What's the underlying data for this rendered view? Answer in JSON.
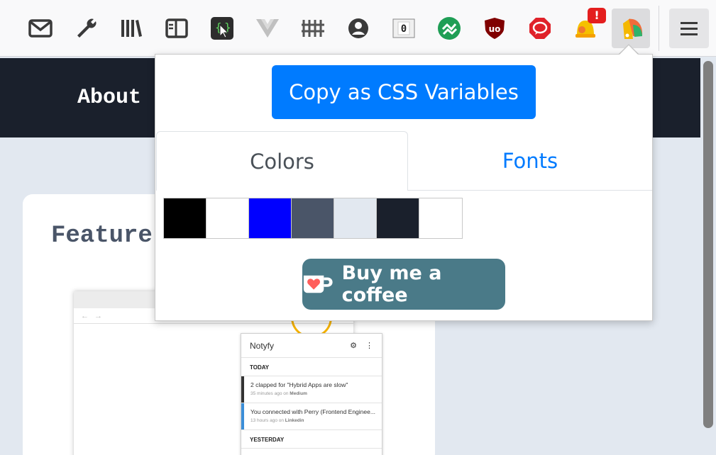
{
  "toolbar": {
    "icons": [
      {
        "name": "mail-icon"
      },
      {
        "name": "wrench-icon"
      },
      {
        "name": "library-icon"
      },
      {
        "name": "sidebar-icon"
      },
      {
        "name": "selector-icon"
      },
      {
        "name": "vue-devtools-icon"
      },
      {
        "name": "grid-icon"
      },
      {
        "name": "account-icon"
      },
      {
        "name": "counter-icon",
        "label": "0"
      },
      {
        "name": "extension-green-icon"
      },
      {
        "name": "ublock-icon",
        "label": "uo"
      },
      {
        "name": "stop-chat-icon"
      },
      {
        "name": "notification-bell-icon",
        "badge": "!"
      },
      {
        "name": "palette-extension-icon"
      }
    ]
  },
  "page": {
    "nav_about": "About",
    "card_title": "Feature",
    "mock": {
      "back": "←",
      "forward": "→",
      "app_title": "Notyfy",
      "settings_glyph": "⚙",
      "more_glyph": "⋮",
      "section_today": "TODAY",
      "items": [
        {
          "text": "2 clapped for \"Hybrid Apps are slow\"",
          "time": "35 minutes ago on",
          "source": "Medium"
        },
        {
          "text": "You connected with Perry (Frontend Enginee...",
          "time": "13 hours ago on",
          "source": "Linkedin"
        }
      ],
      "section_yesterday": "YESTERDAY"
    }
  },
  "popup": {
    "copy_button": "Copy as CSS Variables",
    "tabs": {
      "colors": "Colors",
      "fonts": "Fonts"
    },
    "active_tab": "Colors",
    "swatches": [
      "#000000",
      "#ffffff",
      "#0000ff",
      "#4a5568",
      "#e2e8f0",
      "#1a202c",
      "#ffffff"
    ],
    "coffee_button": "Buy me a coffee"
  },
  "colors": {
    "accent": "#007bff",
    "coffee": "#4a7a88",
    "header_dark": "#1a202c",
    "page_bg": "#e2e8f0"
  }
}
